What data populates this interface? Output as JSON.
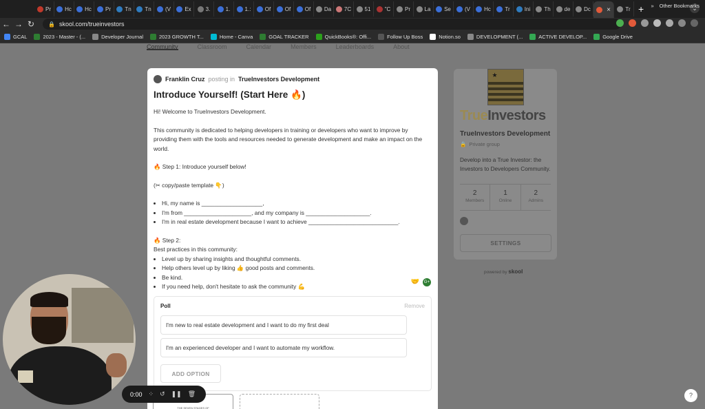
{
  "browser": {
    "tabs": [
      "Pr",
      "Hc",
      "Hc",
      "Pr",
      "Tn",
      "Tn",
      "(V",
      "Ex",
      "3.",
      "1.",
      "1.:",
      "Of",
      "Of",
      "Of",
      "Da",
      "7C",
      "51",
      "\"C",
      "Pr",
      "La",
      "Se",
      "(V",
      "Hc",
      "Tr",
      "Ini",
      "Th",
      "de",
      "Dc",
      "",
      "Tr"
    ],
    "active_tab_index": 28,
    "new_tab_label": "+",
    "url": "skool.com/trueinvestors",
    "bookmarks": [
      "GCAL",
      "2023 - Master - (...",
      "Developer Journal",
      "2023 GROWTH T...",
      "Home - Canva",
      "GOAL TRACKER",
      "QuickBooks®: Offi...",
      "Follow Up Boss",
      "Notion.so",
      "DEVELOPMENT (...",
      "ACTIVE DEVELOP...",
      "Google Drive"
    ],
    "bookmarks_more": "»",
    "other_bookmarks": "Other Bookmarks"
  },
  "subnav": [
    "Community",
    "Classroom",
    "Calendar",
    "Members",
    "Leaderboards",
    "About"
  ],
  "post": {
    "author": "Franklin Cruz",
    "posting_in": "posting in",
    "group": "TrueInvestors Development",
    "title": "Introduce Yourself! (Start Here 🔥)",
    "welcome": "Hi! Welcome to TrueInvestors Development.",
    "intro": "This community is dedicated to helping developers in training or developers who want to improve by providing them with the tools and resources needed to generate development and make an impact on the world.",
    "step1": "🔥 Step 1: Introduce yourself below!",
    "template_note": "(✂ copy/paste template 👇)",
    "template_lines": [
      "Hi, my name is ___________________,",
      "I'm from _____________________, and my company is ____________________.",
      "I'm in real estate development because I want to achieve ____________________________."
    ],
    "step2": "🔥 Step 2:",
    "best_practices_title": "Best practices in this community:",
    "best_practices": [
      "Level up by sharing insights and thoughtful comments.",
      "Help others level up by liking 👍 good posts and comments.",
      "Be kind.",
      "If you need help, don't hesitate to ask the community 💪"
    ],
    "reaction_icon": "🤝",
    "reaction_badge": "G+"
  },
  "poll": {
    "label": "Poll",
    "remove": "Remove",
    "options": [
      "I'm new to real estate development and I want to do my first deal",
      "I'm an experienced developer and I want to automate my workflow."
    ],
    "add_option": "ADD OPTION"
  },
  "attachment_caption": "THE SEVEN STAGES OF",
  "group_card": {
    "logo_text_1": "True",
    "logo_text_2": "Investors",
    "name": "TrueInvestors Development",
    "privacy": "Private group",
    "description": "Develop into a True Investor: the Investors to Developers Community.",
    "stats": [
      {
        "num": "2",
        "label": "Members"
      },
      {
        "num": "1",
        "label": "Online"
      },
      {
        "num": "2",
        "label": "Admins"
      }
    ],
    "settings": "SETTINGS",
    "powered_by": "powered by",
    "powered_brand": "skool"
  },
  "help": "?",
  "recorder": {
    "time": "0:00"
  },
  "colors": {
    "logo_gold": "#9b8a52",
    "logo_dark": "#444444",
    "overlay": "#7a7a7a"
  }
}
